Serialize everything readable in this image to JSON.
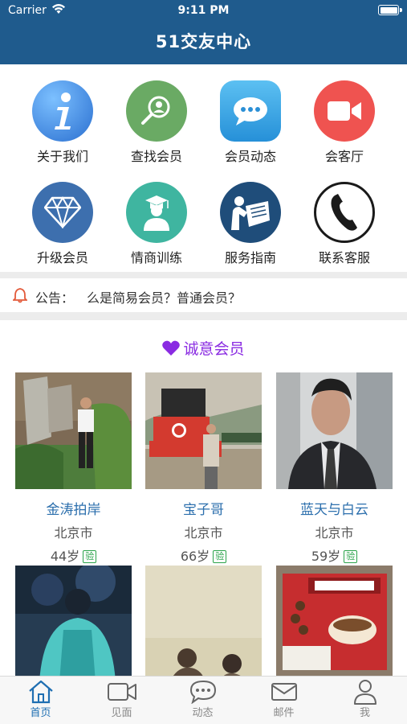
{
  "status": {
    "carrier": "Carrier",
    "time": "9:11 PM"
  },
  "nav": {
    "title": "51交友中心"
  },
  "menu": [
    {
      "label": "关于我们",
      "icon": "info-icon",
      "color": "#3f8fe0"
    },
    {
      "label": "查找会员",
      "icon": "search-user-icon",
      "color": "#6aaa64"
    },
    {
      "label": "会员动态",
      "icon": "chat-bubble-icon",
      "color": "#3aa7e6"
    },
    {
      "label": "会客厅",
      "icon": "video-camera-icon",
      "color": "#ef5350"
    },
    {
      "label": "升级会员",
      "icon": "diamond-icon",
      "color": "#3d6fae"
    },
    {
      "label": "情商训练",
      "icon": "graduate-icon",
      "color": "#3fb5a0"
    },
    {
      "label": "服务指南",
      "icon": "reading-person-icon",
      "color": "#1f4d7a"
    },
    {
      "label": "联系客服",
      "icon": "phone-icon",
      "color": "#1a1a1a"
    }
  ],
  "notice": {
    "label": "公告：",
    "text": "么是简易会员？普通会员？"
  },
  "section": {
    "title": "诚意会员",
    "accent": "#8a2be2"
  },
  "members": [
    {
      "name": "金涛拍岸",
      "city": "北京市",
      "age": "44岁",
      "badge": "验"
    },
    {
      "name": "宝子哥",
      "city": "北京市",
      "age": "66岁",
      "badge": "验"
    },
    {
      "name": "蓝天与白云",
      "city": "北京市",
      "age": "59岁",
      "badge": "验"
    },
    {
      "name": "",
      "city": "",
      "age": "",
      "badge": ""
    },
    {
      "name": "",
      "city": "",
      "age": "",
      "badge": ""
    },
    {
      "name": "",
      "city": "",
      "age": "",
      "badge": ""
    }
  ],
  "tabs": [
    {
      "label": "首页",
      "icon": "home-icon",
      "active": true
    },
    {
      "label": "见面",
      "icon": "video-icon",
      "active": false
    },
    {
      "label": "动态",
      "icon": "chat-icon",
      "active": false
    },
    {
      "label": "邮件",
      "icon": "mail-icon",
      "active": false
    },
    {
      "label": "我",
      "icon": "user-icon",
      "active": false
    }
  ]
}
